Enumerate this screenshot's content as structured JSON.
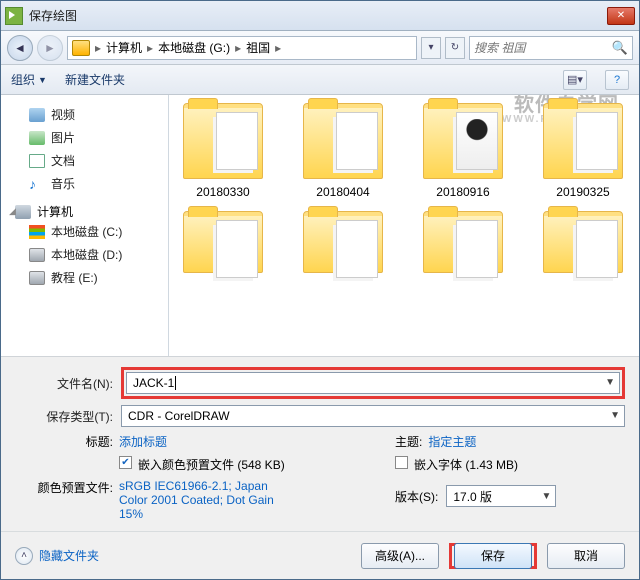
{
  "titlebar": {
    "title": "保存绘图"
  },
  "nav": {
    "crumbs": [
      "计算机",
      "本地磁盘 (G:)",
      "祖国"
    ],
    "search_placeholder": "搜索 祖国"
  },
  "toolbar": {
    "organize": "组织",
    "new_folder": "新建文件夹"
  },
  "sidebar": {
    "items": [
      {
        "label": "视频",
        "icon": "video"
      },
      {
        "label": "图片",
        "icon": "img"
      },
      {
        "label": "文档",
        "icon": "doc"
      },
      {
        "label": "音乐",
        "icon": "music"
      }
    ],
    "computer": {
      "label": "计算机",
      "drives": [
        {
          "label": "本地磁盘 (C:)",
          "icon": "winflag"
        },
        {
          "label": "本地磁盘 (D:)",
          "icon": "drive"
        },
        {
          "label": "教程 (E:)",
          "icon": "drive"
        }
      ]
    }
  },
  "folders": {
    "row1": [
      "20180330",
      "20180404",
      "20180916",
      "20190325"
    ]
  },
  "watermark": {
    "main": "软件自学网",
    "sub": "WWW.RJZXW.COM"
  },
  "form": {
    "filename_label": "文件名(N):",
    "filename_value": "JACK-1",
    "filetype_label": "保存类型(T):",
    "filetype_value": "CDR - CorelDRAW",
    "title_label": "标题:",
    "title_value": "添加标题",
    "subject_label": "主题:",
    "subject_value": "指定主题",
    "embed_color_label": "嵌入颜色预置文件 (548 KB)",
    "color_profile_label": "颜色预置文件:",
    "color_profile_value": "sRGB IEC61966-2.1; Japan Color 2001 Coated; Dot Gain 15%",
    "embed_font_label": "嵌入字体 (1.43 MB)",
    "version_label": "版本(S):",
    "version_value": "17.0 版"
  },
  "footer": {
    "hide": "隐藏文件夹",
    "advanced": "高级(A)...",
    "save": "保存",
    "cancel": "取消"
  }
}
